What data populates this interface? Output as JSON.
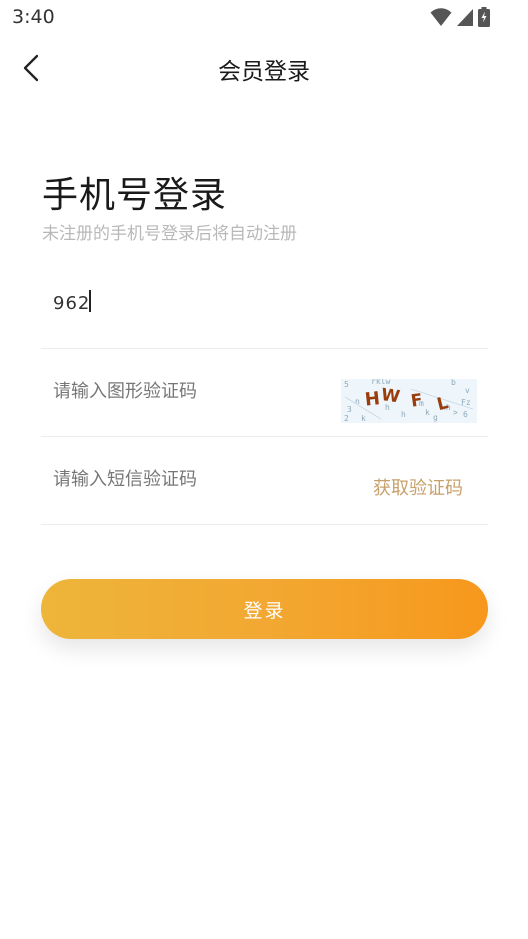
{
  "status_bar": {
    "time": "3:40",
    "icons": [
      "wifi-icon",
      "signal-icon",
      "battery-icon"
    ]
  },
  "nav": {
    "title": "会员登录",
    "back_icon": "chevron-left-icon"
  },
  "login": {
    "title": "手机号登录",
    "subtitle": "未注册的手机号登录后将自动注册"
  },
  "form": {
    "phone": {
      "value": "962",
      "placeholder": ""
    },
    "captcha": {
      "placeholder": "请输入图形验证码",
      "image_text": "HWFL"
    },
    "sms": {
      "placeholder": "请输入短信验证码",
      "get_code_label": "获取验证码"
    }
  },
  "submit": {
    "label": "登录"
  },
  "colors": {
    "accent_start": "#eeb53b",
    "accent_end": "#f7981c",
    "link": "#c8a06a",
    "placeholder": "#777777",
    "subtitle": "#b8b8b8"
  }
}
